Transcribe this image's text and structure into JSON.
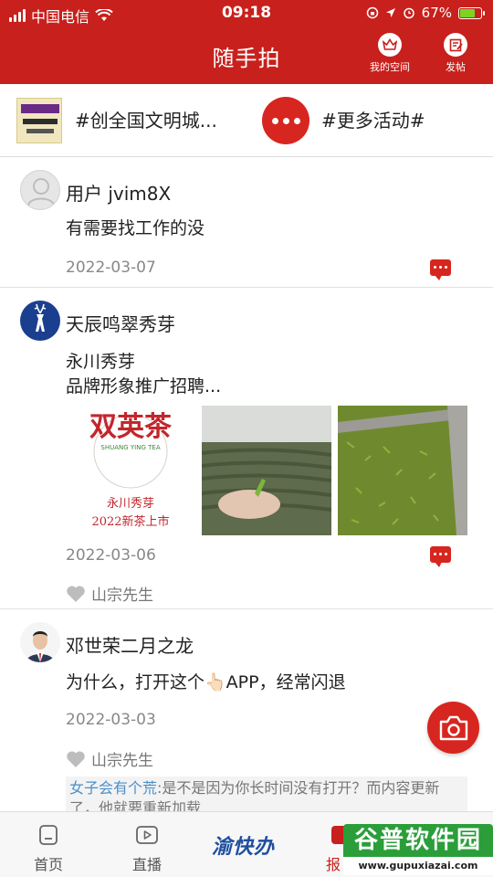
{
  "status_bar": {
    "carrier": "中国电信",
    "time": "09:18",
    "battery": "67%",
    "battery_level": 0.67
  },
  "header": {
    "title": "随手拍",
    "my_space_label": "我的空间",
    "post_label": "发帖"
  },
  "topics": {
    "left": "#创全国文明城...",
    "right": "#更多活动#"
  },
  "posts": [
    {
      "username": "用户 jvim8X",
      "content": "有需要找工作的没",
      "date": "2022-03-07"
    },
    {
      "username": "天辰鸣翠秀芽",
      "content_line1": "永川秀芽",
      "content_line2": "品牌形象推广招聘...",
      "images": {
        "logo_big": "双英茶",
        "logo_small": "SHUANG YING TEA",
        "caption1": "永川秀芽",
        "caption2": "2022新茶上市"
      },
      "date": "2022-03-06",
      "liked_by": "山宗先生"
    },
    {
      "username": "邓世荣二月之龙",
      "content": "为什么，打开这个👆🏻APP，经常闪退",
      "date": "2022-03-03",
      "liked_by": "山宗先生",
      "reply_name": "女子会有个荒",
      "reply_text": ":是不是因为你长时间没有打开？而内容更新了，他就要重新加载"
    }
  ],
  "tabbar": {
    "home": "首页",
    "live": "直播",
    "logo": "渝快办",
    "report": "报"
  },
  "watermark": {
    "title": "谷普软件园",
    "url": "www.gupuxiazai.com"
  },
  "colors": {
    "brand_red": "#c8201c",
    "accent_red": "#d7261f",
    "reply_name_blue": "#4a90c8"
  }
}
